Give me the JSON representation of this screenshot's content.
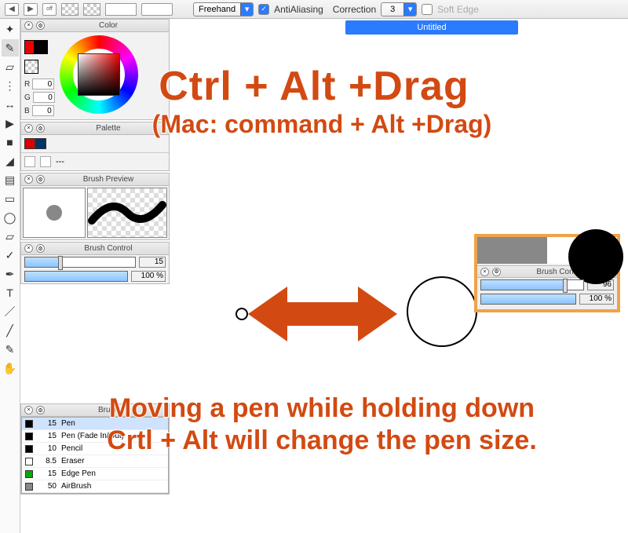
{
  "topbar": {
    "mode": "Freehand",
    "antialias_label": "AntiAliasing",
    "correction_label": "Correction",
    "correction_value": "3",
    "softedge_label": "Soft Edge"
  },
  "doc_tab": "Untitled",
  "panels": {
    "color": {
      "title": "Color",
      "r_label": "R",
      "r_val": "0",
      "g_label": "G",
      "g_val": "0",
      "b_label": "B",
      "b_val": "0"
    },
    "palette": {
      "title": "Palette",
      "placeholder": "---"
    },
    "brush_preview": {
      "title": "Brush Preview"
    },
    "brush_control": {
      "title": "Brush Control",
      "size_value": "15",
      "opacity_value": "100 %"
    },
    "brush": {
      "title": "Brush"
    }
  },
  "brushes": [
    {
      "size": "15",
      "name": "Pen",
      "color": "k",
      "selected": true
    },
    {
      "size": "15",
      "name": "Pen (Fade In/Out)",
      "color": "k",
      "selected": false
    },
    {
      "size": "10",
      "name": "Pencil",
      "color": "k",
      "selected": false
    },
    {
      "size": "8.5",
      "name": "Eraser",
      "color": "w",
      "selected": false
    },
    {
      "size": "15",
      "name": "Edge Pen",
      "color": "g",
      "selected": false
    },
    {
      "size": "50",
      "name": "AirBrush",
      "color": "gr",
      "selected": false
    }
  ],
  "inset": {
    "title": "Brush Control",
    "size_value": "96",
    "opacity_value": "100 %"
  },
  "annotations": {
    "line1": "Ctrl + Alt +Drag",
    "line2": "(Mac: command + Alt +Drag)",
    "line3a": "Moving a pen while holding down",
    "line3b": "Crtl + Alt will change the pen size."
  }
}
